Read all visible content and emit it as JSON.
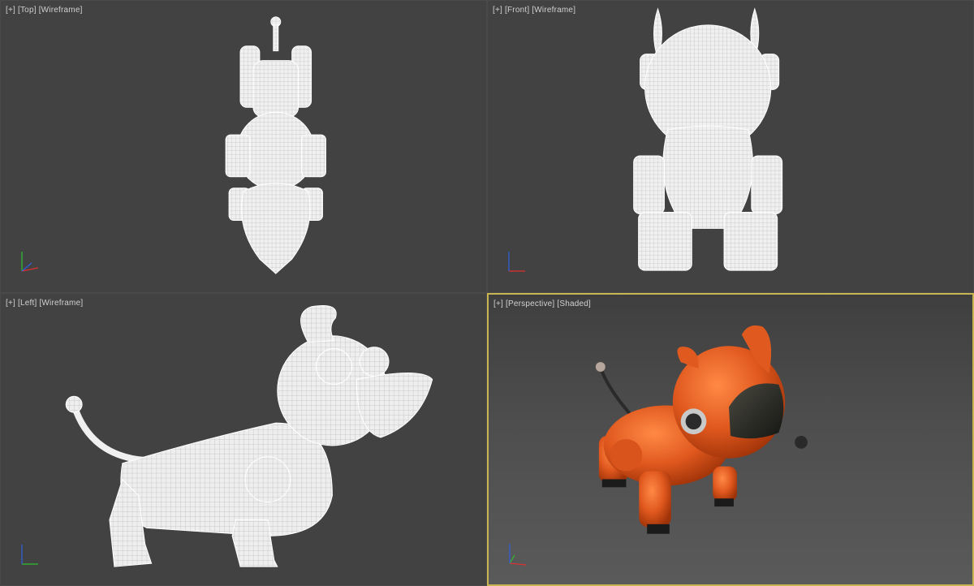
{
  "viewports": {
    "top": {
      "plus": "[+]",
      "view": "[Top]",
      "mode": "[Wireframe]"
    },
    "front": {
      "plus": "[+]",
      "view": "[Front]",
      "mode": "[Wireframe]"
    },
    "left": {
      "plus": "[+]",
      "view": "[Left]",
      "mode": "[Wireframe]"
    },
    "perspective": {
      "plus": "[+]",
      "view": "[Perspective]",
      "mode": "[Shaded]"
    }
  },
  "colors": {
    "viewport_bg": "#424242",
    "wireframe": "#efefef",
    "active_border": "#c8b450",
    "model_orange": "#e0581e",
    "axis_x": "#e03030",
    "axis_y": "#30c030",
    "axis_z": "#3060e0"
  },
  "icons": [
    "axis-tripod-icon"
  ]
}
